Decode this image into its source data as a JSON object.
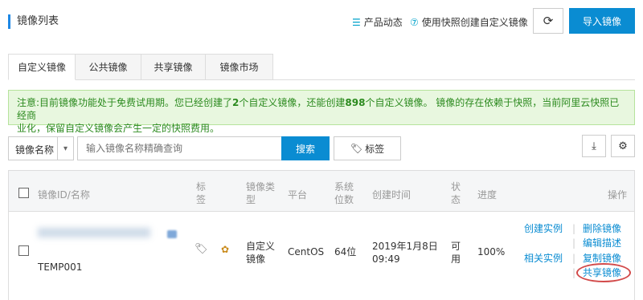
{
  "header": {
    "title": "镜像列表",
    "product_news": "产品动态",
    "help_link": "使用快照创建自定义镜像",
    "import_label": "导入镜像"
  },
  "tabs": [
    {
      "label": "自定义镜像",
      "active": true
    },
    {
      "label": "公共镜像",
      "active": false
    },
    {
      "label": "共享镜像",
      "active": false
    },
    {
      "label": "镜像市场",
      "active": false
    }
  ],
  "notice": {
    "part1": "注意:目前镜像功能处于免费试用期。您已经创建了",
    "created": "2",
    "part2": "个自定义镜像，还能创建",
    "remaining": "898",
    "part3": "个自定义镜像。 镜像的存在依赖于快照，当前阿里云快照已经商",
    "line2": "业化，保留自定义镜像会产生一定的快照费用。"
  },
  "search": {
    "field_label": "镜像名称",
    "placeholder": "输入镜像名称精确查询",
    "search_label": "搜索",
    "tag_label": "标签"
  },
  "table": {
    "headers": {
      "id_name": "镜像ID/名称",
      "tag_1": "标",
      "tag_2": "签",
      "type_1": "镜像类",
      "type_2": "型",
      "platform": "平台",
      "bits_1": "系统",
      "bits_2": "位数",
      "created": "创建时间",
      "status_1": "状",
      "status_2": "态",
      "progress": "进度",
      "actions": "操作"
    },
    "rows": [
      {
        "name": "TEMP001",
        "type_1": "自定义",
        "type_2": "镜像",
        "platform": "CentOS",
        "bits": "64位",
        "created_1": "2019年1月8日",
        "created_2": "09:49",
        "status_1": "可",
        "status_2": "用",
        "progress": "100%",
        "actions": {
          "create_instance": "创建实例",
          "related_instance": "相关实例",
          "delete": "删除镜像",
          "edit_desc": "编辑描述",
          "copy": "复制镜像",
          "share": "共享镜像"
        }
      }
    ]
  },
  "colors": {
    "primary": "#0a8cd2",
    "notice_bg": "#e8f7df",
    "notice_text": "#2b8a1e",
    "highlight_circle": "#d24a4a"
  }
}
